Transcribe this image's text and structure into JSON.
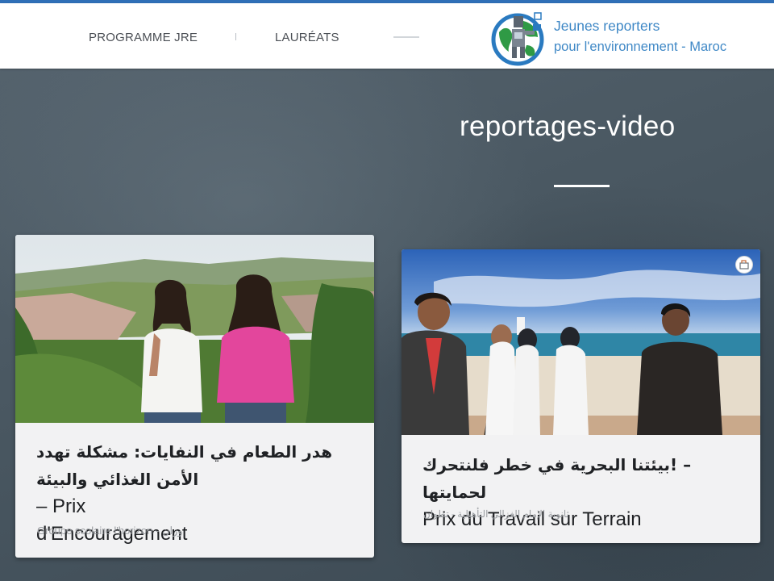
{
  "header": {
    "nav": [
      {
        "label": "PROGRAMME JRE"
      },
      {
        "label": "LAURÉATS"
      }
    ],
    "brand": {
      "line1": "Jeunes reporters",
      "line2": "pour l'environnement - Maroc"
    }
  },
  "page": {
    "title": "reportages-video"
  },
  "cards": [
    {
      "title_ar": "هدر الطعام في النفايات: مشكلة تهدد الأمن الغذائي والبيئة",
      "title_fr_prefix": "– Prix",
      "title_fr": "d'Encouragement",
      "meta": "Groupe scolaire l'horizon - وزان"
    },
    {
      "title_ar": "– !بيئتنا البحرية في خطر فلنتحرك لحمايتها",
      "title_fr": "Prix du Travail sur Terrain",
      "meta": "ثانوية الإمام الغزالي التأهيلية - تطوان"
    }
  ],
  "colors": {
    "accent": "#3f88c6",
    "top_border": "#2f6fb7",
    "background": "#46545f",
    "card": "#f2f2f3"
  },
  "icons": [
    "logo-icon",
    "share-icon"
  ]
}
